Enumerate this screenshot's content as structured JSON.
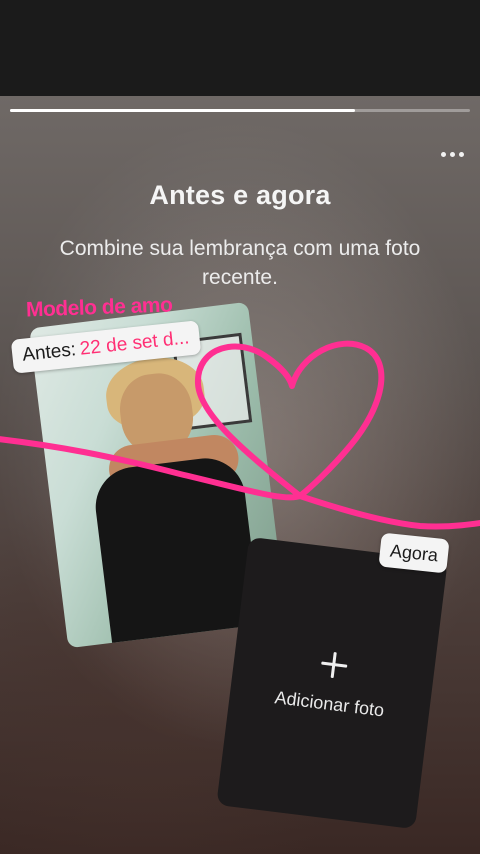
{
  "story": {
    "progress": 0.75,
    "title": "Antes e agora",
    "subtitle": "Combine sua lembrança com uma foto recente.",
    "sticker_text": "Modelo de amo",
    "before_chip": {
      "label": "Antes:",
      "date": "22 de set d..."
    },
    "after_chip": {
      "label": "Agora"
    },
    "add_photo_label": "Adicionar foto",
    "icons": {
      "more": "more-horizontal-icon",
      "add": "plus-icon",
      "heart": "heart-scribble-icon"
    },
    "colors": {
      "accent_pink": "#ff2f92",
      "date_pink": "#ff2f74",
      "chip_bg": "#f4f4f4",
      "card_bg": "#1d1b1c"
    }
  }
}
